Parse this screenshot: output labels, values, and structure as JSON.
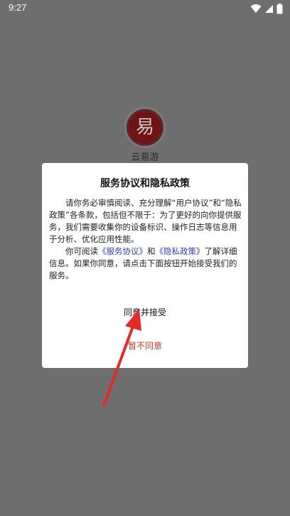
{
  "status_bar": {
    "time": "9:27",
    "icons": [
      "wifi-icon",
      "cellular-signal-icon",
      "battery-icon"
    ]
  },
  "splash": {
    "logo_glyph": "易",
    "app_name": "云易游"
  },
  "dialog": {
    "title": "服务协议和隐私政策",
    "para1": "请你务必审慎阅读、充分理解“用户协议”和“隐私政策”各条款，包括但不限于：为了更好的向你提供服务，我们需要收集你的设备标识、操作日志等信息用于分析、优化应用性能。",
    "para2_prefix": "你可阅读",
    "link_service": "《服务协议》",
    "para2_and": "和",
    "link_privacy": "《隐私政策》",
    "para2_suffix": "了解详细信息。如果你同意，请点击下面按钮开始接受我们的服务。",
    "agree_label": "同意并接受",
    "disagree_label": "暂不同意"
  },
  "colors": {
    "overlay": "#6e6e6e",
    "dialog_bg": "#ffffff",
    "link": "#2f3fb5",
    "disagree": "#c0392b",
    "arrow": "#e32b2b"
  }
}
